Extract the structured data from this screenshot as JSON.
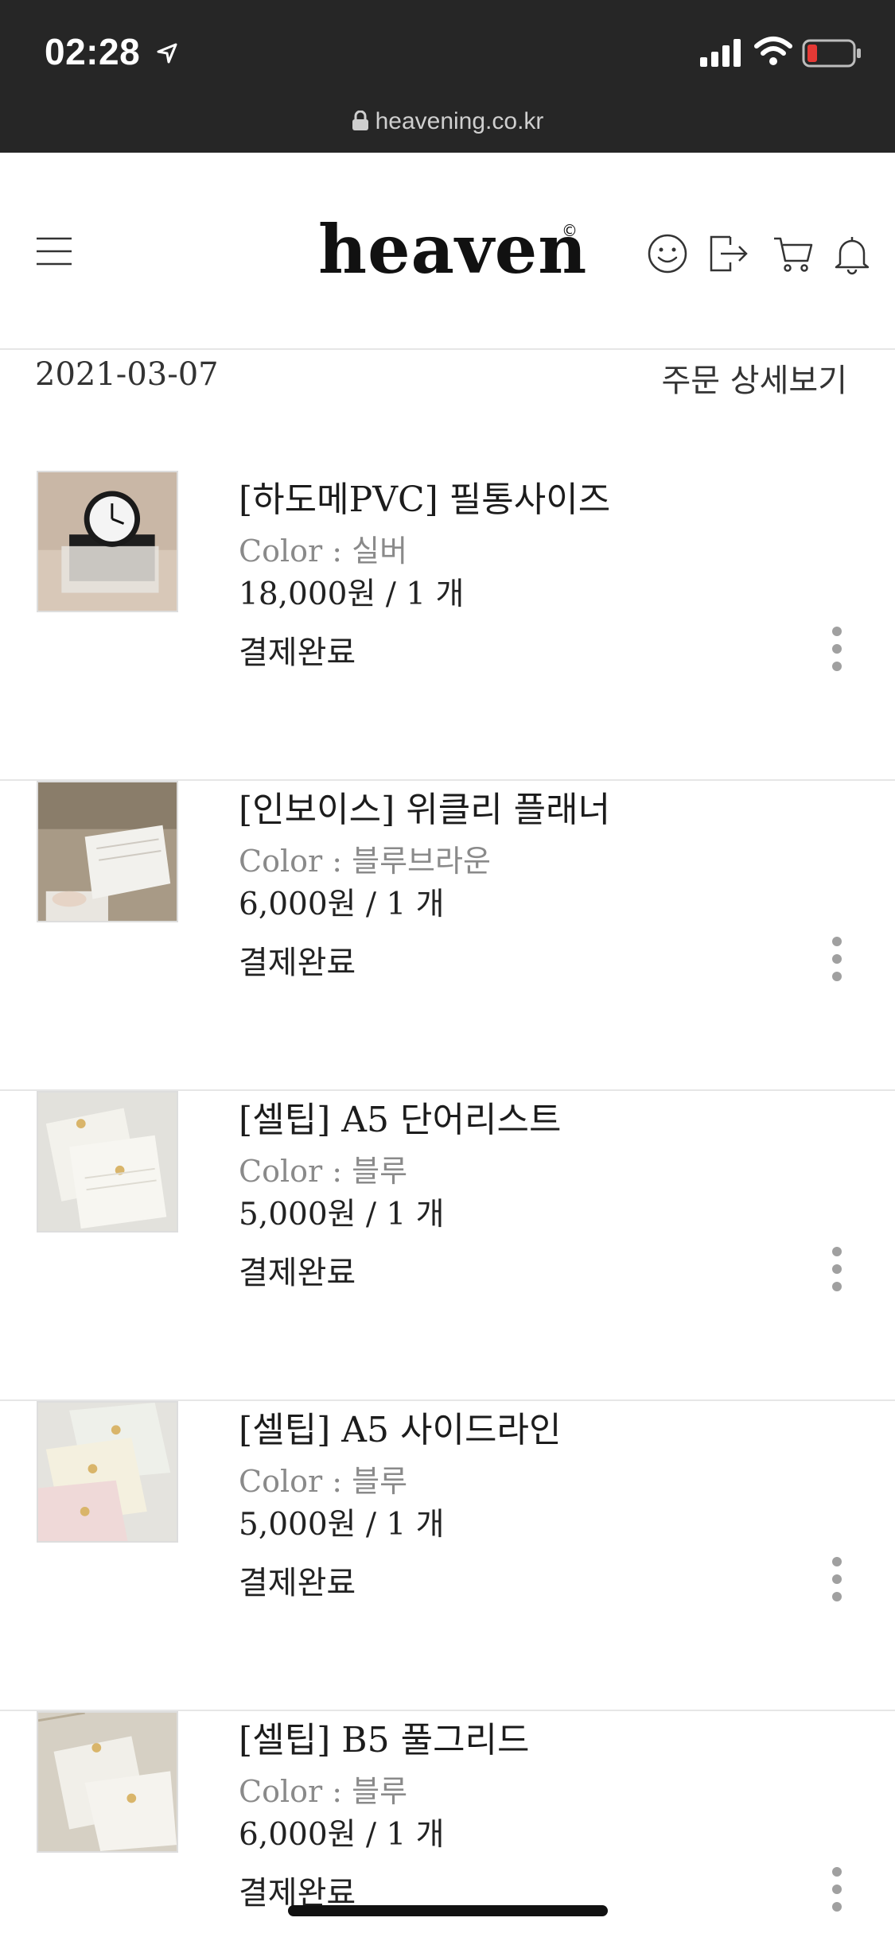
{
  "status_bar": {
    "time": "02:28"
  },
  "browser": {
    "url": "heavening.co.kr"
  },
  "header": {
    "logo": "heaven",
    "logo_mark": "©"
  },
  "order": {
    "date": "2021-03-07",
    "detail_link": "주문 상세보기"
  },
  "items": [
    {
      "name": "[하도메PVC] 필통사이즈",
      "color": "Color : 실버",
      "price": "18,000원 / 1 개",
      "status": "결제완료"
    },
    {
      "name": "[인보이스] 위클리 플래너",
      "color": "Color : 블루브라운",
      "price": "6,000원 / 1 개",
      "status": "결제완료"
    },
    {
      "name": "[셀팁] A5 단어리스트",
      "color": "Color : 블루",
      "price": "5,000원 / 1 개",
      "status": "결제완료"
    },
    {
      "name": "[셀팁] A5 사이드라인",
      "color": "Color : 블루",
      "price": "5,000원 / 1 개",
      "status": "결제완료"
    },
    {
      "name": "[셀팁] B5 풀그리드",
      "color": "Color : 블루",
      "price": "6,000원 / 1 개",
      "status": "결제완료"
    }
  ],
  "colors": {
    "status_bar_bg": "#262626",
    "battery_low": "#e53935",
    "divider": "#e6e6e6",
    "muted_text": "#8a8a8a"
  }
}
